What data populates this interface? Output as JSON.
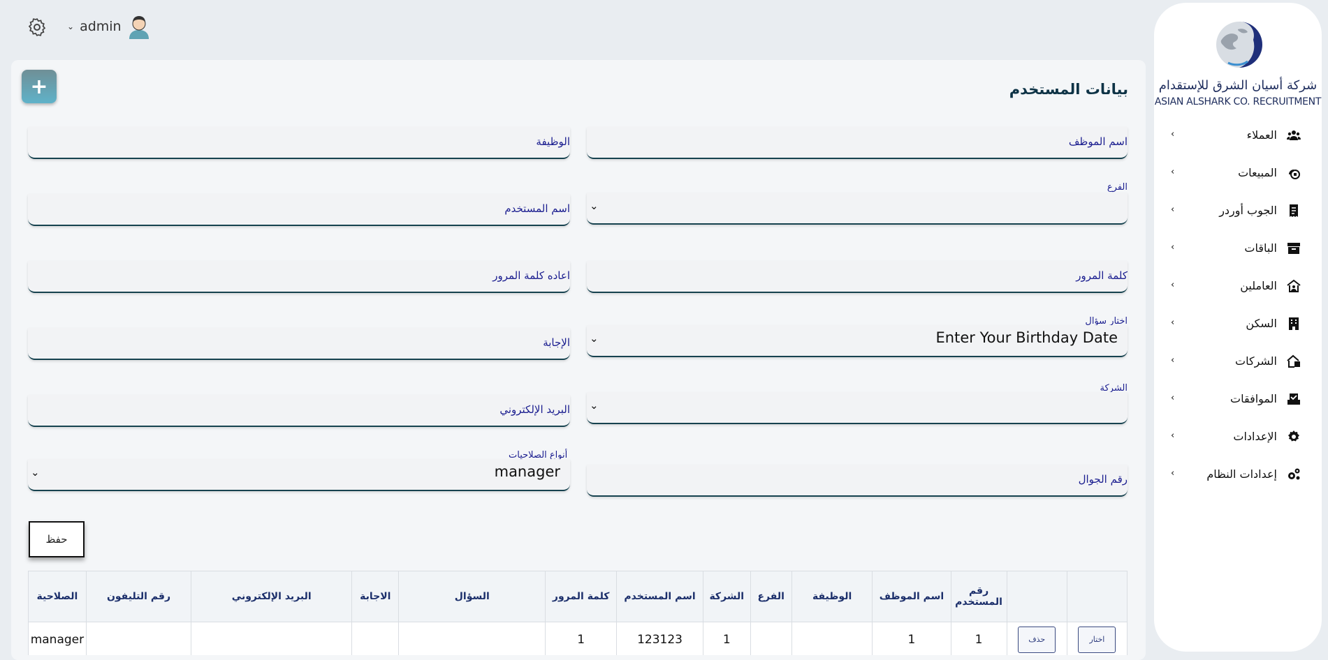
{
  "topbar": {
    "user_name": "admin"
  },
  "page": {
    "title": "بيانات المستخدم"
  },
  "form": {
    "employee_name_label": "اسم الموظف",
    "job_label": "الوظيفة",
    "branch_label": "الفرع",
    "username_label": "اسم المستخدم",
    "password_label": "كلمة المرور",
    "confirm_password_label": "اعاده كلمة المرور",
    "question_label": "اختار سؤال",
    "question_value": "Enter Your Birthday Date",
    "answer_label": "الإجابة",
    "company_label": "الشركة",
    "email_label": "البريد الإلكتروني",
    "mobile_label": "رقم الجوال",
    "permissions_label": "أنواع الصلاحيات",
    "permissions_value": "manager",
    "save_label": "حفظ"
  },
  "table": {
    "headers": [
      "",
      "",
      "رقم المستخدم",
      "اسم الموظف",
      "الوظيفة",
      "الفرع",
      "الشركة",
      "اسم المستخدم",
      "كلمة المرور",
      "السؤال",
      "الاجابة",
      "البريد الإلكتروني",
      "رقم التليفون",
      "الصلاحية"
    ],
    "rows": [
      {
        "select_label": "اختار",
        "delete_label": "حذف",
        "user_no": "1",
        "employee": "1",
        "job": "",
        "branch": "",
        "company": "1",
        "username": "123123",
        "password": "1",
        "question": "",
        "answer": "",
        "email": "",
        "phone": "",
        "permission": "manager"
      }
    ]
  },
  "sidebar": {
    "brand_ar": "شركة أسيان الشرق للإستقدام",
    "brand_en": "ASIAN ALSHARK CO. RECRUITMENT",
    "items": [
      {
        "label": "العملاء",
        "icon": "users-icon"
      },
      {
        "label": "المبيعات",
        "icon": "sales-icon"
      },
      {
        "label": "الجوب أوردر",
        "icon": "receipt-icon"
      },
      {
        "label": "الباقات",
        "icon": "archive-icon"
      },
      {
        "label": "العاملين",
        "icon": "workers-icon"
      },
      {
        "label": "السكن",
        "icon": "building-icon"
      },
      {
        "label": "الشركات",
        "icon": "company-icon"
      },
      {
        "label": "الموافقات",
        "icon": "approval-icon"
      },
      {
        "label": "الإعدادات",
        "icon": "gear-icon"
      },
      {
        "label": "إعدادات النظام",
        "icon": "gears-icon"
      }
    ]
  }
}
